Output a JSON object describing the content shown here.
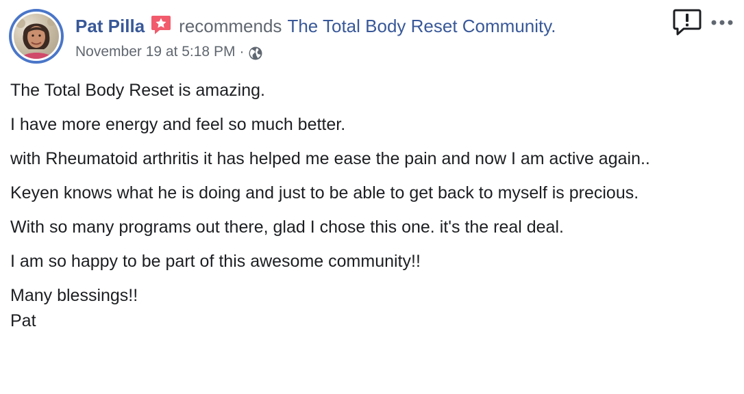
{
  "post": {
    "author": "Pat Pilla",
    "verb": "recommends",
    "page": "The Total Body Reset Community.",
    "timestamp": "November 19 at 5:18 PM",
    "separator": "·",
    "privacy_icon": "globe-icon",
    "badge_icon": "recommendation-star-icon",
    "report_icon": "report-exclamation-icon",
    "more_icon": "more-options-icon",
    "paragraphs": [
      "The Total Body Reset is amazing.",
      "I have more energy and feel so much better.",
      "with Rheumatoid arthritis it has helped me ease the pain and now I am active again..",
      "Keyen knows what he is doing and just to be able to get back to myself is precious.",
      "With so many programs out there, glad I chose this one. it's the real deal.",
      "I am so happy to be part of this awesome community!!"
    ],
    "closing": "Many blessings!!",
    "signature": "Pat"
  },
  "colors": {
    "link": "#385898",
    "muted": "#606770",
    "text": "#1c1e21",
    "avatar_ring": "#4a76c8",
    "badge": "#f15b6c"
  }
}
